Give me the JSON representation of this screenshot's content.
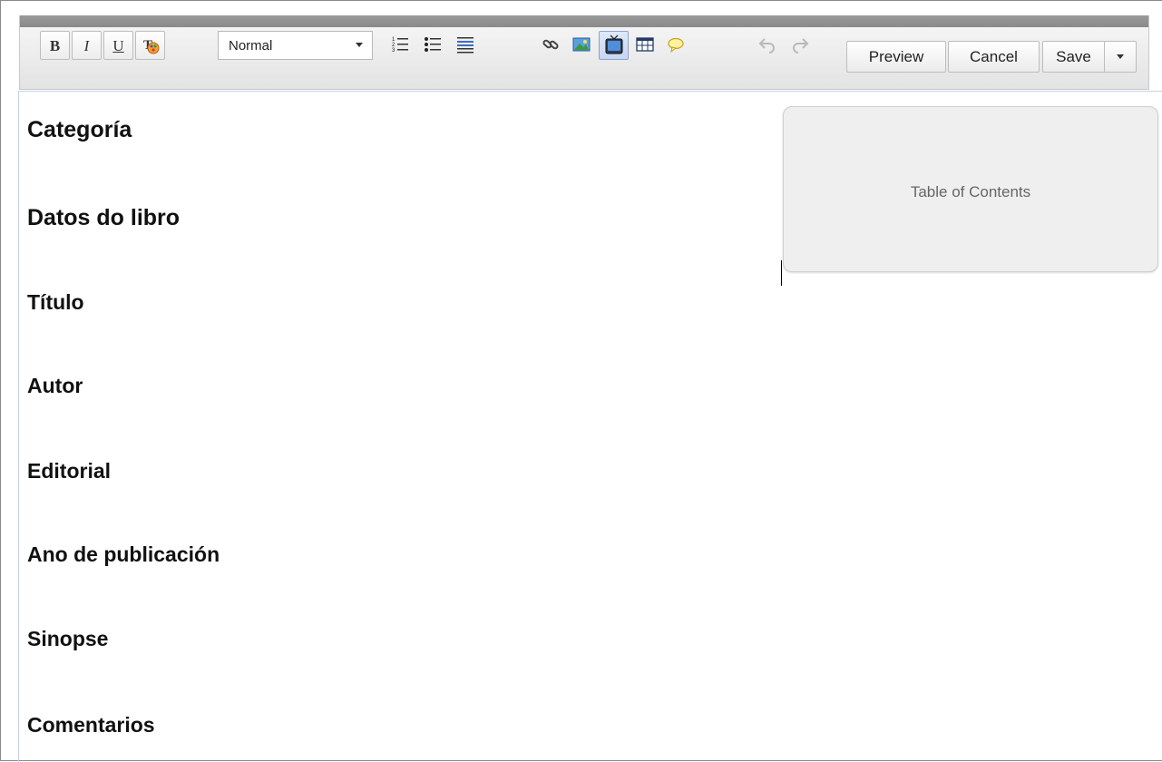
{
  "toolbar": {
    "bold_label": "B",
    "italic_label": "I",
    "underline_label": "U",
    "format_select": {
      "value": "Normal"
    },
    "icons": {
      "text_color": "text-color-icon",
      "numbered_list": "numbered-list-icon",
      "bullet_list": "bullet-list-icon",
      "justify": "justify-icon",
      "link": "link-icon",
      "image": "image-icon",
      "video": "video-icon",
      "table": "table-icon",
      "comment": "comment-icon",
      "undo": "undo-icon",
      "redo": "redo-icon",
      "save_dropdown": "chevron-down-icon"
    },
    "preview_label": "Preview",
    "cancel_label": "Cancel",
    "save_label": "Save"
  },
  "content": {
    "headings": [
      {
        "text": "Categoría"
      },
      {
        "text": "Datos do libro"
      },
      {
        "text": "Título"
      },
      {
        "text": "Autor"
      },
      {
        "text": "Editorial"
      },
      {
        "text": "Ano de publicación"
      },
      {
        "text": "Sinopse"
      },
      {
        "text": "Comentarios"
      }
    ],
    "toc": {
      "label": "Table of Contents"
    }
  },
  "colors": {
    "toolbar_top": "#8a8a8a",
    "active_button": "#c7d6f2",
    "editor_border": "#c5d2ea",
    "toc_background": "#efefef"
  }
}
